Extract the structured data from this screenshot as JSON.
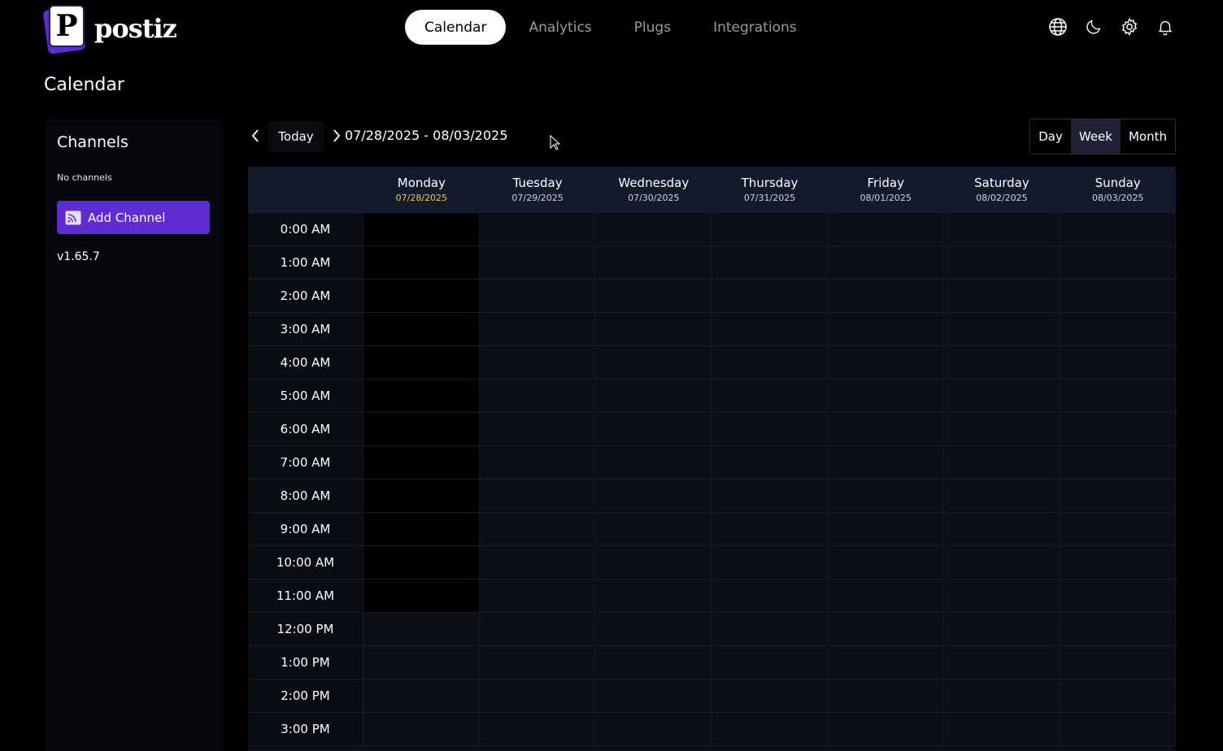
{
  "brand": {
    "name": "postiz",
    "mark_letter": "P",
    "accent": "#612bd3"
  },
  "nav": {
    "items": [
      {
        "label": "Calendar",
        "active": true
      },
      {
        "label": "Analytics",
        "active": false
      },
      {
        "label": "Plugs",
        "active": false
      },
      {
        "label": "Integrations",
        "active": false
      }
    ]
  },
  "top_icons": [
    "globe-icon",
    "moon-icon",
    "settings-icon",
    "bell-icon"
  ],
  "page": {
    "title": "Calendar"
  },
  "sidebar": {
    "heading": "Channels",
    "empty_text": "No channels",
    "add_button": "Add Channel",
    "version": "v1.65.7"
  },
  "calendar": {
    "today_label": "Today",
    "range": "07/28/2025 - 08/03/2025",
    "views": [
      {
        "label": "Day",
        "active": false
      },
      {
        "label": "Week",
        "active": true
      },
      {
        "label": "Month",
        "active": false
      }
    ],
    "days": [
      {
        "name": "Monday",
        "date": "07/28/2025",
        "today": true
      },
      {
        "name": "Tuesday",
        "date": "07/29/2025",
        "today": false
      },
      {
        "name": "Wednesday",
        "date": "07/30/2025",
        "today": false
      },
      {
        "name": "Thursday",
        "date": "07/31/2025",
        "today": false
      },
      {
        "name": "Friday",
        "date": "08/01/2025",
        "today": false
      },
      {
        "name": "Saturday",
        "date": "08/02/2025",
        "today": false
      },
      {
        "name": "Sunday",
        "date": "08/03/2025",
        "today": false
      }
    ],
    "hours": [
      "0:00 AM",
      "1:00 AM",
      "2:00 AM",
      "3:00 AM",
      "4:00 AM",
      "5:00 AM",
      "6:00 AM",
      "7:00 AM",
      "8:00 AM",
      "9:00 AM",
      "10:00 AM",
      "11:00 AM",
      "12:00 PM",
      "1:00 PM",
      "2:00 PM",
      "3:00 PM"
    ],
    "past_hours_today": 12
  }
}
